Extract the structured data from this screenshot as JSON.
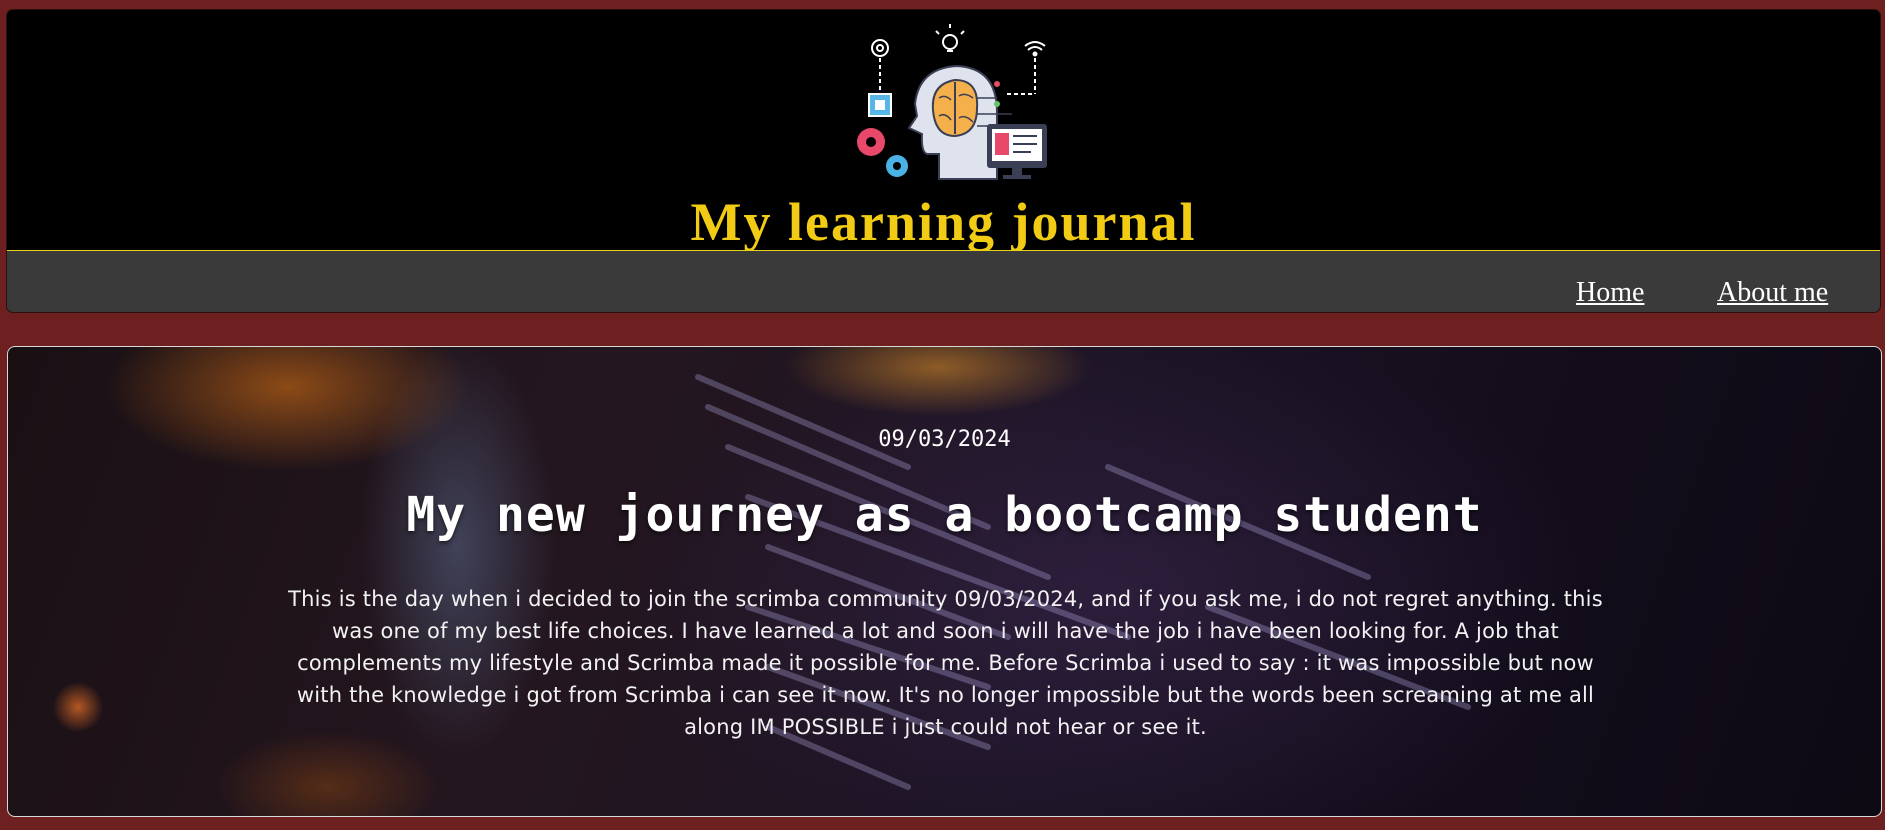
{
  "header": {
    "title": "My learning journal",
    "logo_icon": "ai-brain-head-icon"
  },
  "nav": {
    "items": [
      {
        "label": "Home"
      },
      {
        "label": "About me"
      }
    ]
  },
  "post": {
    "date": "09/03/2024",
    "title": "My new journey as a bootcamp student",
    "body": "This is the day when i decided to join the scrimba community 09/03/2024, and if you ask me, i do not regret anything. this was one of my best life choices. I have learned a lot and soon i will have the job i have been looking for. A job that complements my lifestyle and Scrimba made it possible for me. Before Scrimba i used to say : it was impossible but now with the knowledge i got from Scrimba i can see it now. It's no longer impossible but the words been screaming at me all along IM POSSIBLE i just could not hear or see it."
  },
  "colors": {
    "page_background": "#6e2020",
    "title_yellow": "#f2cc14",
    "navbar": "#3a3a3a"
  }
}
